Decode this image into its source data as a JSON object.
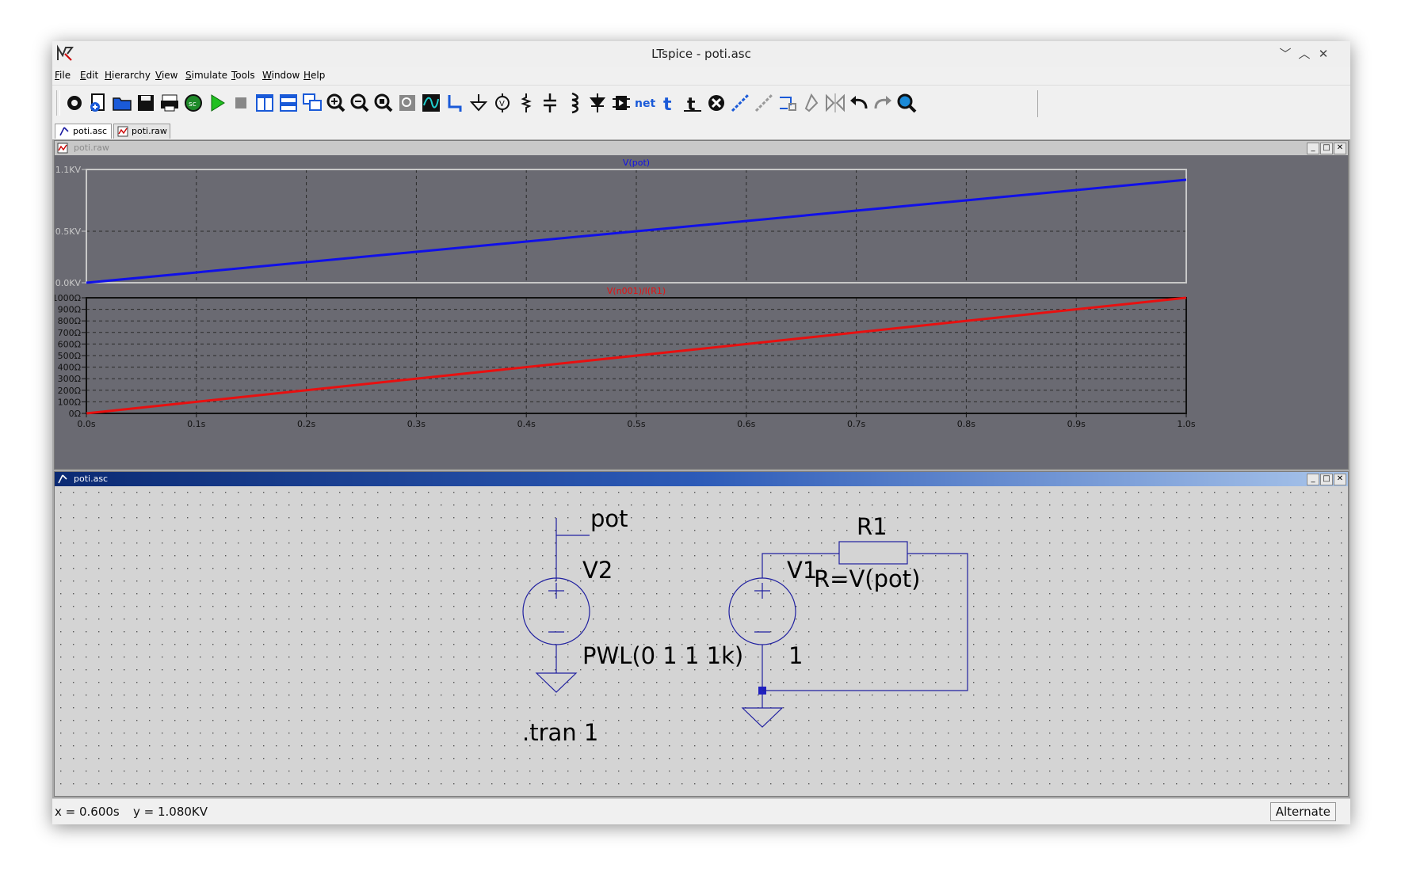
{
  "window": {
    "title": "LTspice - poti.asc"
  },
  "menu": [
    "File",
    "Edit",
    "Hierarchy",
    "View",
    "Simulate",
    "Tools",
    "Window",
    "Help"
  ],
  "toolbar": [
    {
      "name": "settings-icon"
    },
    {
      "name": "new-schematic-icon"
    },
    {
      "name": "open-icon"
    },
    {
      "name": "save-icon"
    },
    {
      "name": "print-icon"
    },
    {
      "name": "control-panel-icon"
    },
    {
      "name": "run-icon"
    },
    {
      "name": "halt-icon"
    },
    {
      "name": "tile-vertical-icon"
    },
    {
      "name": "tile-horizontal-icon"
    },
    {
      "name": "cascade-icon"
    },
    {
      "name": "zoom-in-icon"
    },
    {
      "name": "zoom-out-icon"
    },
    {
      "name": "zoom-fit-icon"
    },
    {
      "name": "zoom-back-icon"
    },
    {
      "name": "autorange-icon"
    },
    {
      "name": "wire-icon"
    },
    {
      "name": "ground-icon"
    },
    {
      "name": "voltage-source-icon"
    },
    {
      "name": "resistor-icon"
    },
    {
      "name": "capacitor-icon"
    },
    {
      "name": "inductor-icon"
    },
    {
      "name": "diode-icon"
    },
    {
      "name": "component-icon"
    },
    {
      "name": "net-label-icon"
    },
    {
      "name": "text-icon"
    },
    {
      "name": "spice-directive-icon"
    },
    {
      "name": "delete-icon"
    },
    {
      "name": "duplicate-icon"
    },
    {
      "name": "move-icon"
    },
    {
      "name": "drag-icon"
    },
    {
      "name": "rotate-icon"
    },
    {
      "name": "mirror-icon"
    },
    {
      "name": "undo-icon"
    },
    {
      "name": "redo-icon"
    },
    {
      "name": "find-icon"
    }
  ],
  "tabs": [
    "poti.asc",
    "poti.raw"
  ],
  "waveform_window": {
    "title": "poti.raw",
    "chart_data": [
      {
        "type": "line",
        "title": "V(pot)",
        "x": [
          0.0,
          1.0
        ],
        "series": [
          {
            "name": "V(pot)",
            "values": [
              0.0,
              1.0
            ],
            "unit": "KV",
            "color": "#1010e8"
          }
        ],
        "xlim": [
          0.0,
          1.0
        ],
        "ylim": [
          0.0,
          1.1
        ],
        "yticks": [
          "0.0KV",
          "0.5KV",
          "1.1KV"
        ],
        "ytick_values": [
          0.0,
          0.5,
          1.1
        ],
        "grid": true
      },
      {
        "type": "line",
        "title": "V(n001)/I(R1)",
        "x": [
          0.0,
          1.0
        ],
        "series": [
          {
            "name": "V(n001)/I(R1)",
            "values": [
              0,
              1000
            ],
            "unit": "Ω",
            "color": "#e81010"
          }
        ],
        "xlim": [
          0.0,
          1.0
        ],
        "ylim": [
          0,
          1000
        ],
        "yticks": [
          "0Ω",
          "100Ω",
          "200Ω",
          "300Ω",
          "400Ω",
          "500Ω",
          "600Ω",
          "700Ω",
          "800Ω",
          "900Ω",
          "1000Ω"
        ],
        "ytick_values": [
          0,
          100,
          200,
          300,
          400,
          500,
          600,
          700,
          800,
          900,
          1000
        ],
        "xticks": [
          "0.0s",
          "0.1s",
          "0.2s",
          "0.3s",
          "0.4s",
          "0.5s",
          "0.6s",
          "0.7s",
          "0.8s",
          "0.9s",
          "1.0s"
        ],
        "xtick_values": [
          0.0,
          0.1,
          0.2,
          0.3,
          0.4,
          0.5,
          0.6,
          0.7,
          0.8,
          0.9,
          1.0
        ],
        "grid": true
      }
    ]
  },
  "schematic_window": {
    "title": "poti.asc",
    "labels": {
      "net_pot": "pot",
      "v2_name": "V2",
      "v2_value": "PWL(0 1 1 1k)",
      "v1_name": "V1",
      "v1_value": "1",
      "r1_name": "R1",
      "r1_value": "R=V(pot)",
      "directive": ".tran 1"
    }
  },
  "status": {
    "x": "x = 0.600s",
    "y": "y = 1.080KV",
    "mode": "Alternate"
  }
}
